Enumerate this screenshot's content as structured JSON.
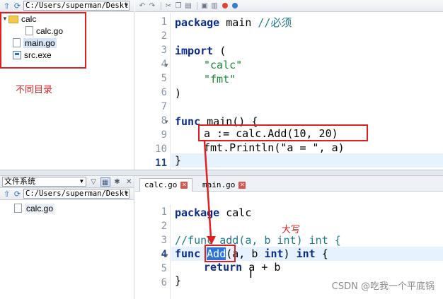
{
  "top": {
    "path": "C:/Users/superman/Deskt",
    "tree": [
      {
        "label": "calc",
        "type": "folder"
      },
      {
        "label": "calc.go",
        "type": "file"
      },
      {
        "label": "main.go",
        "type": "file"
      },
      {
        "label": "src.exe",
        "type": "exe"
      }
    ],
    "note": "不同目录",
    "line_numbers": [
      "1",
      "2",
      "3",
      "4",
      "5",
      "6",
      "7",
      "8",
      "9",
      "10",
      "11"
    ],
    "code": {
      "l1_kw": "package",
      "l1_rest": " main ",
      "l1_cmt": "//必须",
      "l3_kw": "import",
      "l3_rest": " (",
      "l4_str": "\"calc\"",
      "l5_str": "\"fmt\"",
      "l6": ")",
      "l8_kw": "func",
      "l8_rest": " main() {",
      "l9": "a := calc.Add(10, 20)",
      "l10": "fmt.Println(\"a = \", a)",
      "l11": "}"
    }
  },
  "bottom": {
    "panel_title": "文件系统",
    "path": "C:/Users/superman/Deskt",
    "tree": [
      {
        "label": "calc.go"
      }
    ],
    "tabs": [
      {
        "label": "calc.go"
      },
      {
        "label": "main.go"
      }
    ],
    "note": "大写",
    "line_numbers": [
      "1",
      "2",
      "3",
      "4",
      "5",
      "6"
    ],
    "code": {
      "l1_kw": "package",
      "l1_rest": " calc",
      "l3_cmt": "//func add(a, b int) int {",
      "l4_kw": "func",
      "l4_sel": "Add",
      "l4_rest": "(a, b ",
      "l4_kw2": "int",
      "l4_rest2": ") ",
      "l4_kw3": "int",
      "l4_rest3": " {",
      "l5_kw": "return",
      "l5_rest": " a + b",
      "l6": "}"
    }
  },
  "watermark": "CSDN @吃我一个平底锅",
  "colors": {
    "annotation": "#e02020",
    "keyword": "#0a2b8a",
    "string": "#1a8a3a",
    "comment": "#1d7a8f",
    "selection": "#2a74d6"
  }
}
